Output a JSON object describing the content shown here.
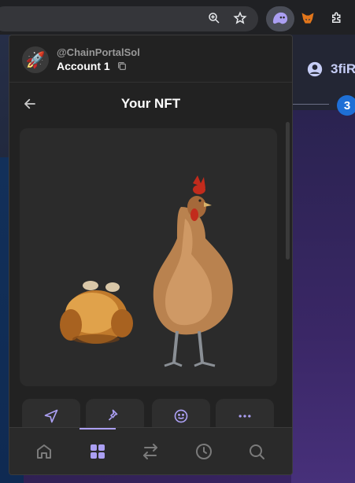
{
  "background": {
    "user_label": "3fiR",
    "step_number": "3"
  },
  "browser": {
    "icons": [
      "zoom-icon",
      "star-icon",
      "phantom-extension-icon",
      "metamask-extension-icon",
      "extensions-puzzle-icon"
    ]
  },
  "popup": {
    "handle": "@ChainPortalSol",
    "account_name": "Account 1",
    "avatar_emoji": "🚀",
    "page_title": "Your NFT",
    "actions": [
      "send-icon",
      "pin-icon",
      "smile-icon",
      "more-icon"
    ],
    "nav": [
      {
        "name": "home",
        "active": false
      },
      {
        "name": "collectibles",
        "active": true
      },
      {
        "name": "swap",
        "active": false
      },
      {
        "name": "activity",
        "active": false
      },
      {
        "name": "search",
        "active": false
      }
    ]
  },
  "colors": {
    "accent": "#ab9ff2",
    "popup_bg": "#222222",
    "badge_blue": "#1e6fd6"
  }
}
